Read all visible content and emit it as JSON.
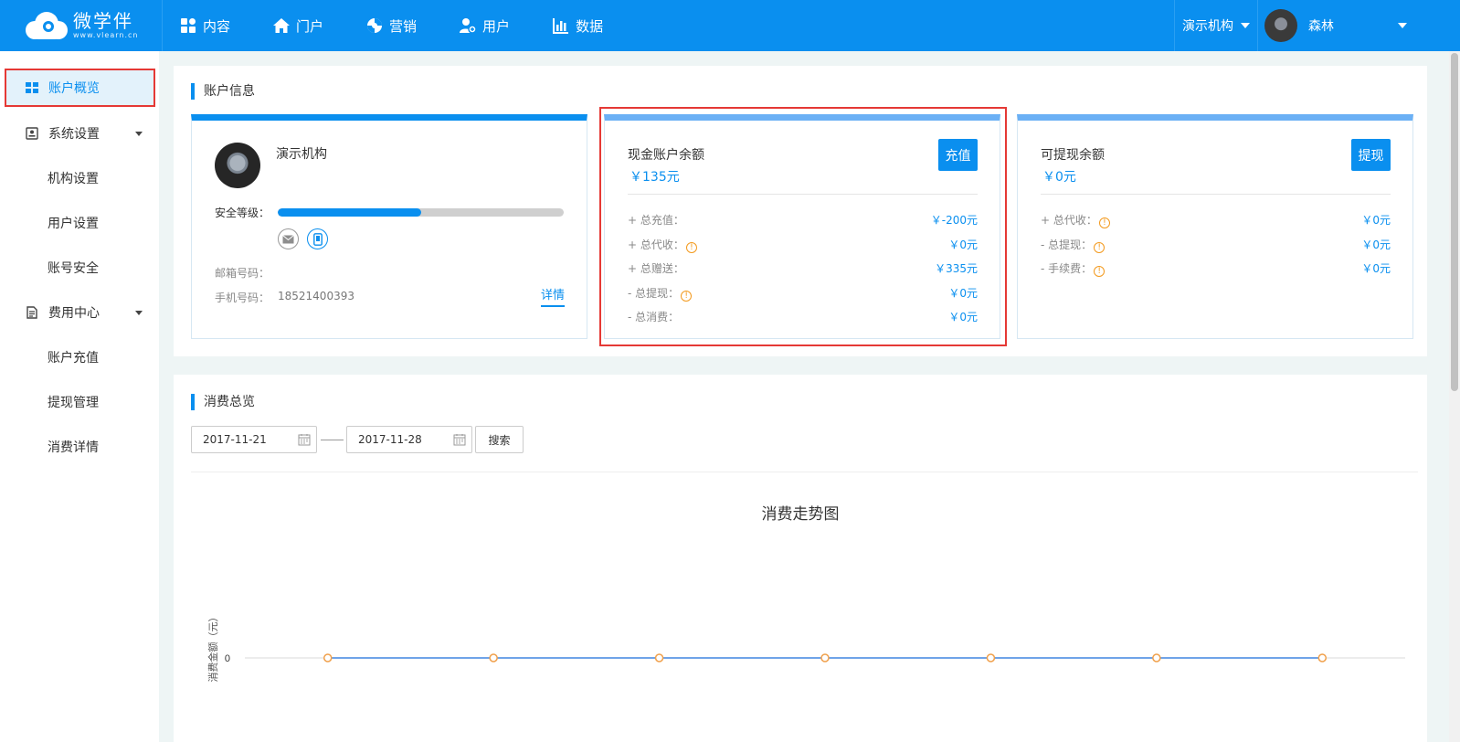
{
  "brand": {
    "name": "微学伴",
    "url": "www.vlearn.cn"
  },
  "nav": {
    "items": [
      {
        "label": "内容",
        "icon": "content-grid-icon"
      },
      {
        "label": "门户",
        "icon": "home-icon"
      },
      {
        "label": "营销",
        "icon": "marketing-icon"
      },
      {
        "label": "用户",
        "icon": "user-icon"
      },
      {
        "label": "数据",
        "icon": "bar-chart-icon"
      }
    ],
    "org_switch": "演示机构",
    "user_name": "森林"
  },
  "sidebar": {
    "overview": "账户概览",
    "system_settings": "系统设置",
    "org_settings": "机构设置",
    "user_settings": "用户设置",
    "account_security": "账号安全",
    "fee_center": "费用中心",
    "recharge": "账户充值",
    "withdraw_mgmt": "提现管理",
    "consumption_detail": "消费详情"
  },
  "account_info": {
    "section_title": "账户信息",
    "org_card": {
      "org_name": "演示机构",
      "security_level_label": "安全等级：",
      "security_level": 0.5,
      "email_label": "邮箱号码：",
      "email_value": "",
      "phone_label": "手机号码：",
      "phone_value": "18521400393",
      "detail_link": "详情"
    },
    "cash_card": {
      "title": "现金账户余额",
      "amount": "￥135元",
      "button": "充值",
      "rows": [
        {
          "label": "+ 总充值：",
          "value": "￥-200元",
          "warn": false
        },
        {
          "label": "+ 总代收：",
          "value": "￥0元",
          "warn": true
        },
        {
          "label": "+ 总赠送：",
          "value": "￥335元",
          "warn": false
        },
        {
          "label": "- 总提现：",
          "value": "￥0元",
          "warn": true
        },
        {
          "label": "- 总消费：",
          "value": "￥0元",
          "warn": false
        }
      ]
    },
    "withdraw_card": {
      "title": "可提现余额",
      "amount": "￥0元",
      "button": "提现",
      "rows": [
        {
          "label": "+ 总代收：",
          "value": "￥0元",
          "warn": true
        },
        {
          "label": "- 总提现：",
          "value": "￥0元",
          "warn": true
        },
        {
          "label": "- 手续费：",
          "value": "￥0元",
          "warn": true
        }
      ]
    }
  },
  "consumption": {
    "section_title": "消费总览",
    "start_date": "2017-11-21",
    "end_date": "2017-11-28",
    "search_button": "搜索",
    "chart_title": "消费走势图"
  },
  "chart_data": {
    "type": "line",
    "title": "消费走势图",
    "ylabel": "消费金额（元）",
    "xlabel": "",
    "x": [
      "",
      "",
      "",
      "",
      "",
      "",
      ""
    ],
    "series": [
      {
        "values": [
          0,
          0,
          0,
          0,
          0,
          0,
          0
        ]
      }
    ],
    "y_ticks": [
      "0"
    ],
    "line_color": "#6fa3e8",
    "marker_color": "#f0a04b"
  },
  "colors": {
    "primary": "#0a8fef",
    "highlight": "#e53935",
    "warn": "#f39a1e"
  }
}
